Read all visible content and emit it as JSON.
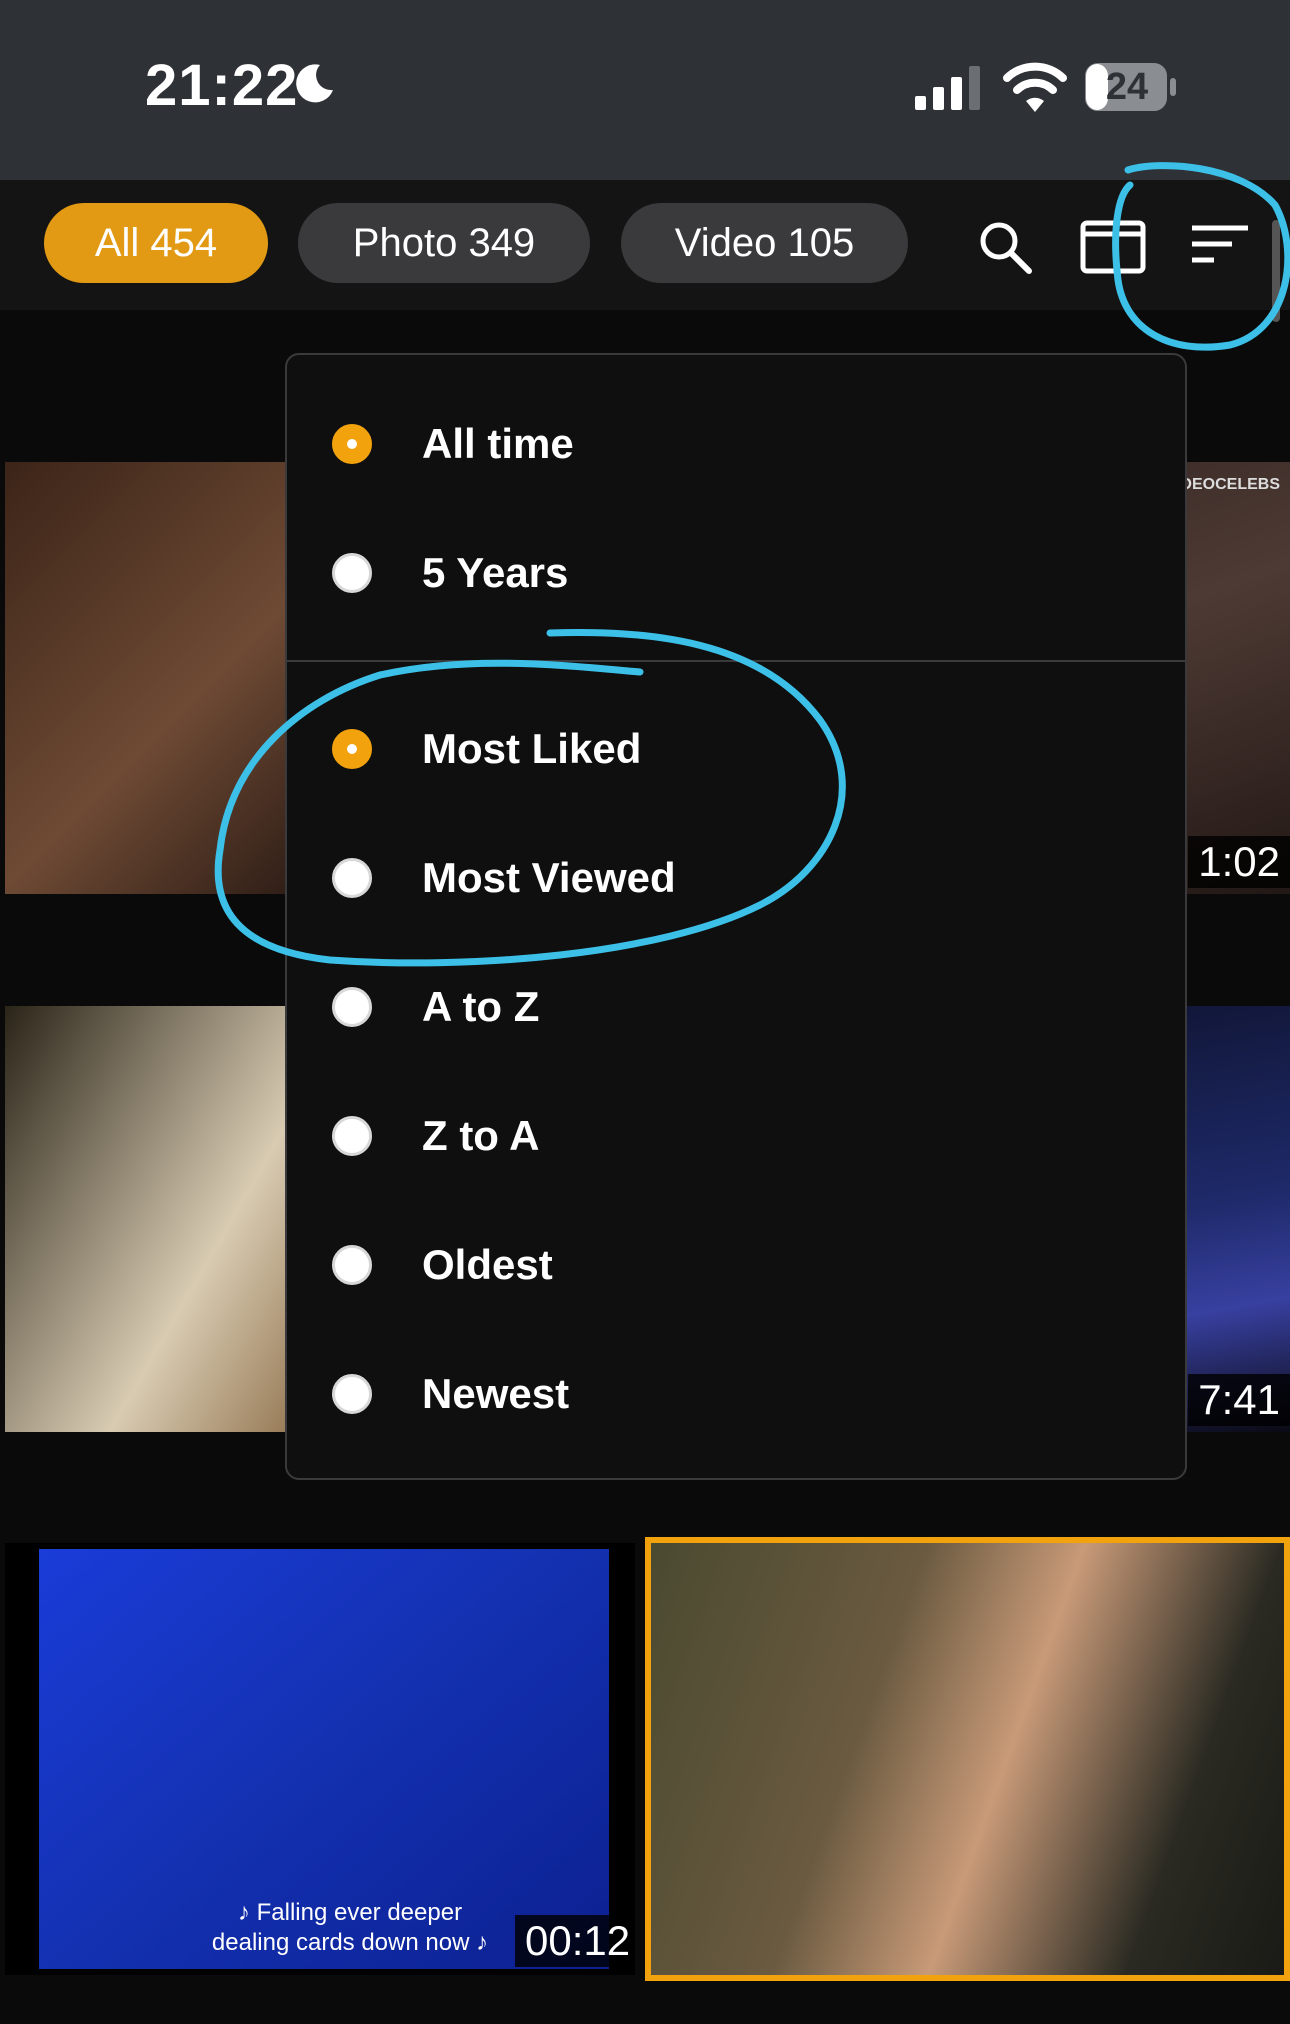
{
  "status_bar": {
    "time": "21:22",
    "battery": "24",
    "icons": [
      "moon-icon",
      "signal-icon",
      "wifi-icon",
      "battery-icon"
    ]
  },
  "filters": {
    "all": "All 454",
    "photo": "Photo 349",
    "video": "Video 105",
    "icons": [
      "search-icon",
      "layout-icon",
      "sort-icon"
    ]
  },
  "sort_menu": {
    "time_range": [
      {
        "label": "All time",
        "selected": true
      },
      {
        "label": "5 Years",
        "selected": false
      }
    ],
    "order": [
      {
        "label": "Most Liked",
        "selected": true
      },
      {
        "label": "Most Viewed",
        "selected": false
      },
      {
        "label": "A to Z",
        "selected": false
      },
      {
        "label": "Z to A",
        "selected": false
      },
      {
        "label": "Oldest",
        "selected": false
      },
      {
        "label": "Newest",
        "selected": false
      }
    ]
  },
  "media": {
    "items": [
      {
        "duration": ""
      },
      {
        "duration": "1:02",
        "watermark": "VIDEOCELEBS"
      },
      {
        "duration": ""
      },
      {
        "duration": "7:41"
      },
      {
        "duration": "00:12",
        "caption_line1": "♪ Falling ever deeper",
        "caption_line2": "dealing cards down now ♪"
      },
      {
        "duration": ""
      }
    ]
  },
  "colors": {
    "accent": "#e29a14",
    "chip_bg": "#3a3a3c",
    "status_bg": "#2e3135",
    "annotation": "#3cc0e8",
    "selection_border": "#f2a20c"
  }
}
